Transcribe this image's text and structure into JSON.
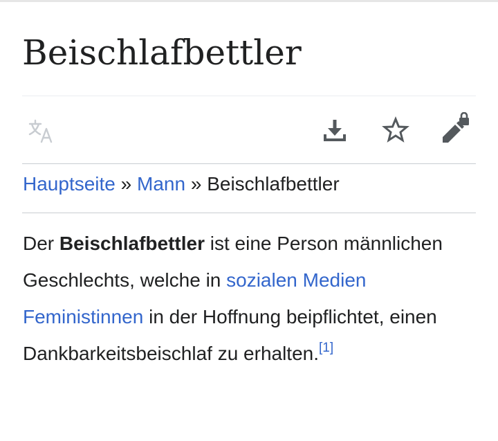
{
  "page": {
    "title": "Beischlafbettler"
  },
  "toolbar": {
    "language_icon": "translate-icon",
    "download_icon": "download-icon",
    "watch_icon": "star-icon",
    "edit_icon": "edit-locked-icon"
  },
  "breadcrumb": {
    "items": [
      "Hauptseite",
      "Mann",
      "Beischlafbettler"
    ],
    "separator": "»"
  },
  "article": {
    "t1": "Der ",
    "bold_term": "Beischlafbettler",
    "t2": " ist eine Person männlichen Geschlechts, welche in ",
    "link_text": "sozialen Medien Feministinnen",
    "t3": " in der Hoffnung beipflichtet, einen Dankbarkeitsbeischlaf zu erhalten.",
    "citation": "[1]"
  },
  "colors": {
    "link": "#3366cc",
    "text": "#202122",
    "icon": "#54595d",
    "icon_disabled": "#c8ccd1",
    "divider": "#c8ccd1"
  }
}
